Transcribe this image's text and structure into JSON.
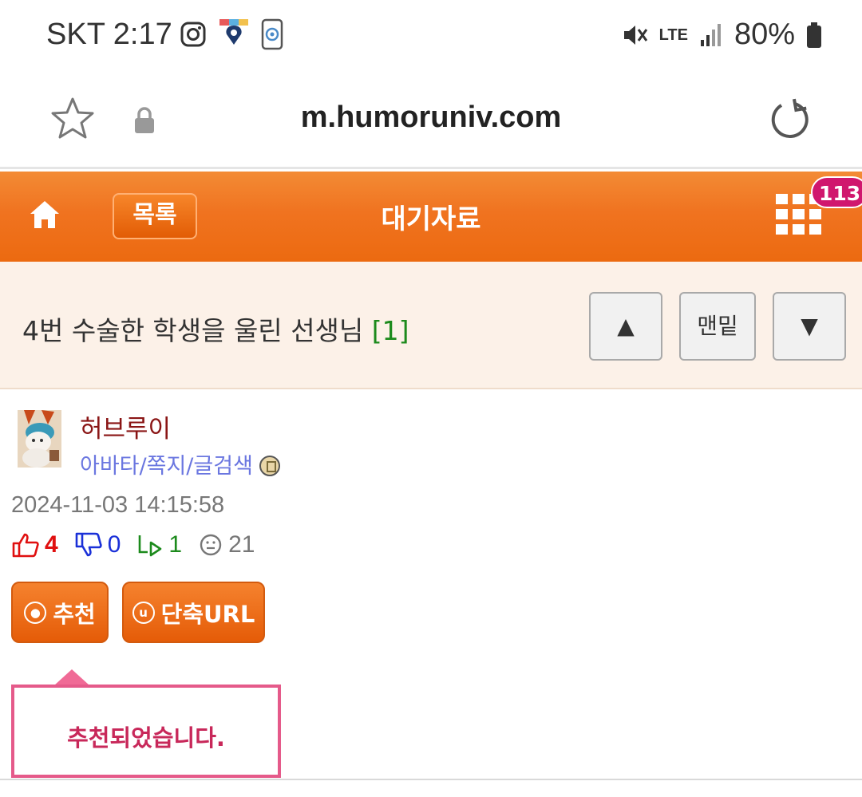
{
  "status_bar": {
    "carrier_time": "SKT 2:17",
    "network": "LTE",
    "battery": "80%"
  },
  "browser": {
    "url": "m.humoruniv.com"
  },
  "header": {
    "list_label": "목록",
    "title": "대기자료",
    "notification_count": "113"
  },
  "post": {
    "title": "4번 수술한 학생을 울린 선생님",
    "comment_count": "[1]",
    "nav": {
      "up": "▲",
      "bottom": "맨밑",
      "down": "▼"
    },
    "author": {
      "name": "허브루이",
      "links": "아바타/쪽지/글검색"
    },
    "date": "2024-11-03 14:15:58",
    "stats": {
      "up": "4",
      "down": "0",
      "replies": "1",
      "views": "21"
    },
    "buttons": {
      "recommend": "추천",
      "short_url": "단축URL"
    },
    "tooltip": "추천되었습니다."
  },
  "colors": {
    "header_orange": "#f07320",
    "badge": "#d0176e",
    "tooltip_border": "#e55a8a"
  }
}
